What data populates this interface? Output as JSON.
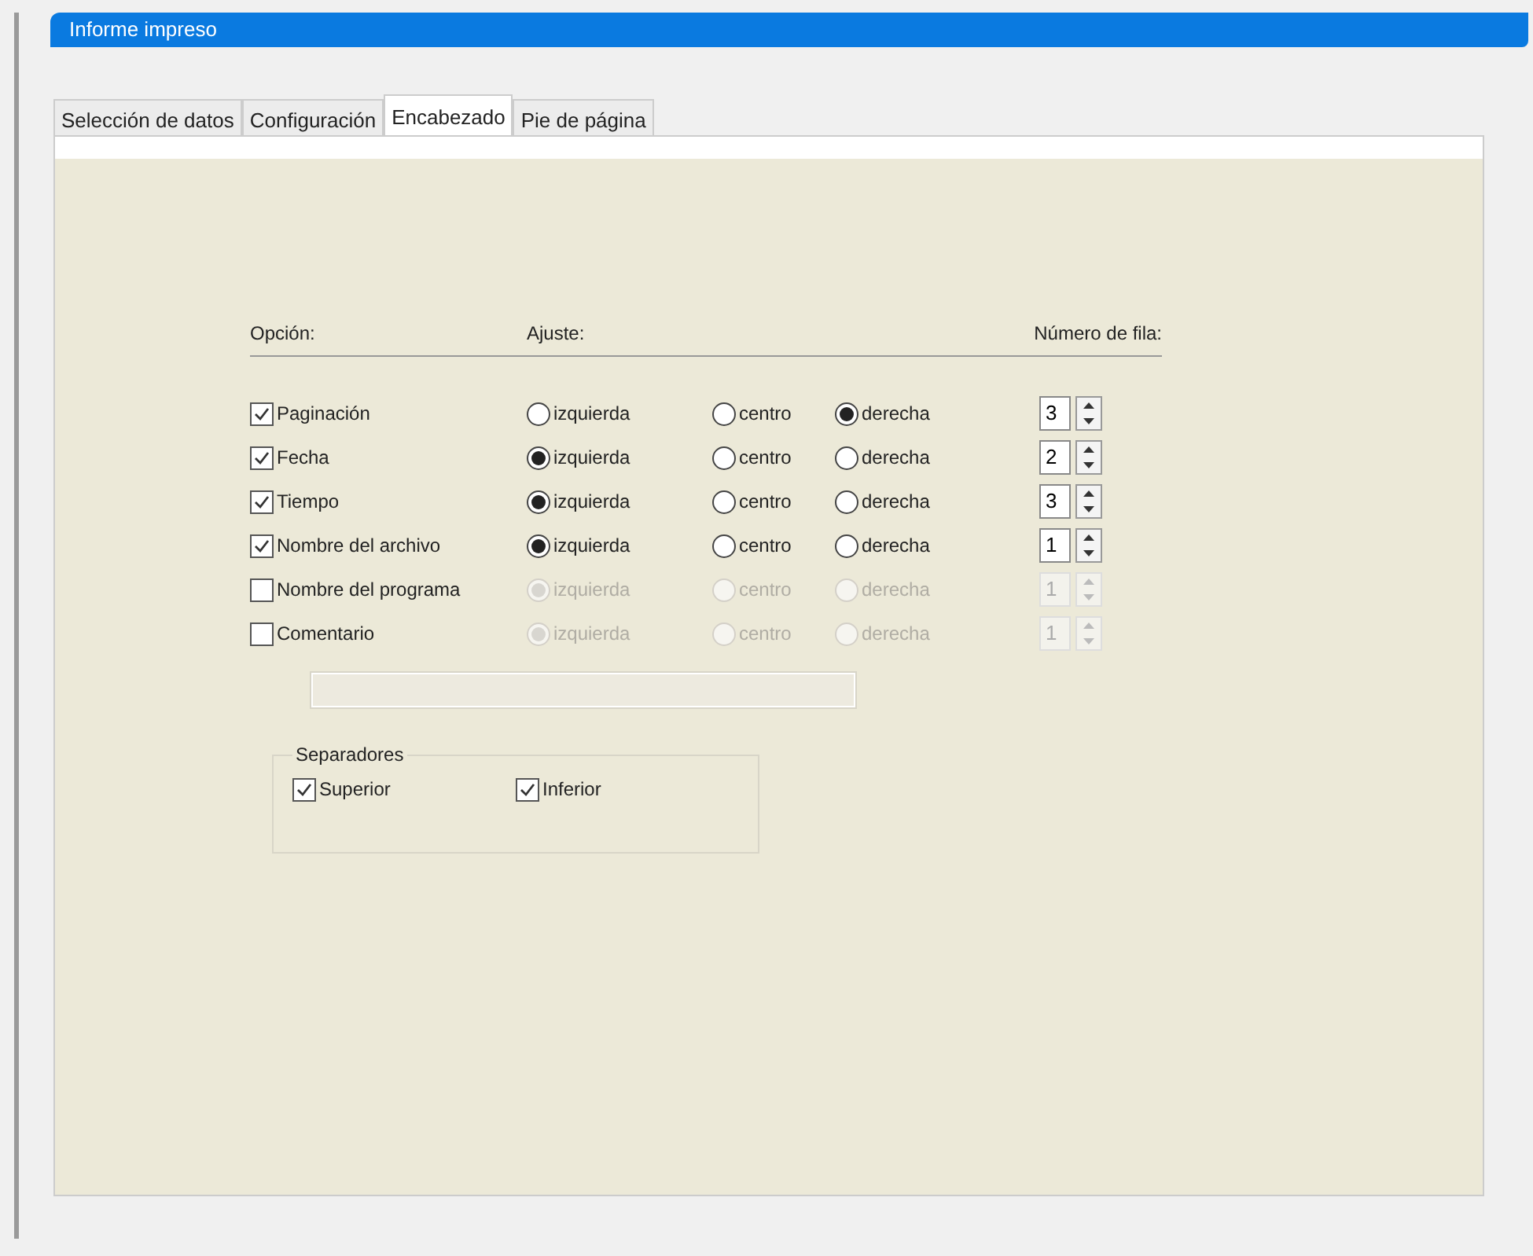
{
  "window": {
    "title": "Informe impreso"
  },
  "tabs": [
    {
      "label": "Selección de datos",
      "selected": false
    },
    {
      "label": "Configuración",
      "selected": false
    },
    {
      "label": "Encabezado",
      "selected": true
    },
    {
      "label": "Pie de página",
      "selected": false
    }
  ],
  "headers": {
    "option": "Opción:",
    "alignment": "Ajuste:",
    "row_number": "Número de fila:"
  },
  "rows": [
    {
      "label": "Paginación",
      "checked": true,
      "alignments": [
        {
          "label": "izquierda",
          "selected": false
        },
        {
          "label": "centro",
          "selected": false
        },
        {
          "label": "derecha",
          "selected": true
        }
      ],
      "row_number": "3"
    },
    {
      "label": "Fecha",
      "checked": true,
      "alignments": [
        {
          "label": "izquierda",
          "selected": true
        },
        {
          "label": "centro",
          "selected": false
        },
        {
          "label": "derecha",
          "selected": false
        }
      ],
      "row_number": "2"
    },
    {
      "label": "Tiempo",
      "checked": true,
      "alignments": [
        {
          "label": "izquierda",
          "selected": true
        },
        {
          "label": "centro",
          "selected": false
        },
        {
          "label": "derecha",
          "selected": false
        }
      ],
      "row_number": "3"
    },
    {
      "label": "Nombre del archivo",
      "checked": true,
      "alignments": [
        {
          "label": "izquierda",
          "selected": true
        },
        {
          "label": "centro",
          "selected": false
        },
        {
          "label": "derecha",
          "selected": false
        }
      ],
      "row_number": "1"
    },
    {
      "label": "Nombre del programa",
      "checked": false,
      "alignments": [
        {
          "label": "izquierda",
          "selected": true
        },
        {
          "label": "centro",
          "selected": false
        },
        {
          "label": "derecha",
          "selected": false
        }
      ],
      "row_number": "1"
    },
    {
      "label": "Comentario",
      "checked": false,
      "alignments": [
        {
          "label": "izquierda",
          "selected": true
        },
        {
          "label": "centro",
          "selected": false
        },
        {
          "label": "derecha",
          "selected": false
        }
      ],
      "row_number": "1"
    }
  ],
  "separators": {
    "title": "Separadores",
    "items": [
      {
        "label": "Superior",
        "checked": true
      },
      {
        "label": "Inferior",
        "checked": true
      }
    ]
  }
}
